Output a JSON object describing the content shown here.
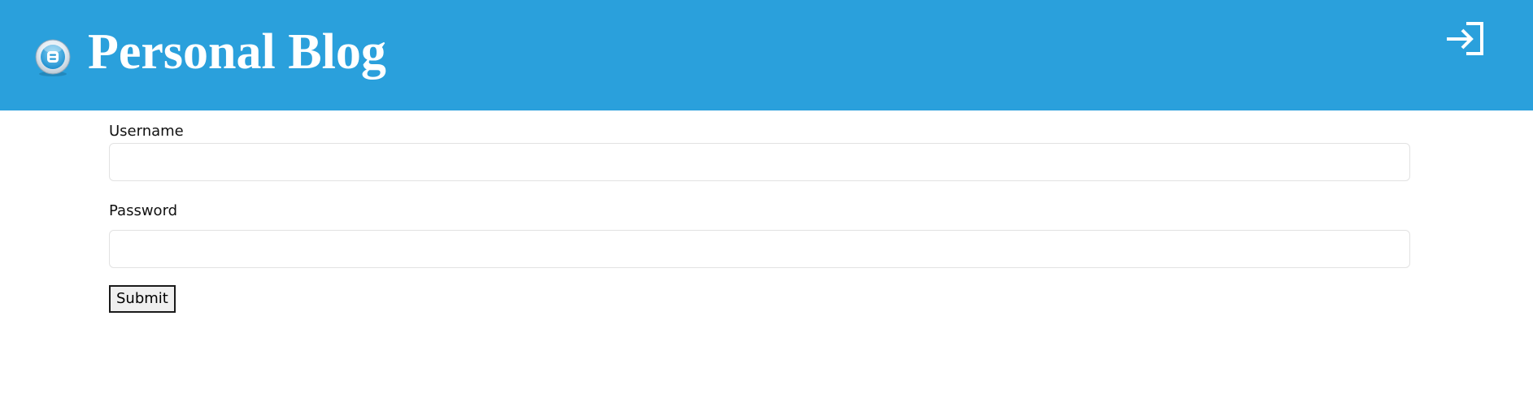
{
  "header": {
    "title": "Personal Blog",
    "logo_icon": "blogger-icon",
    "login_icon": "login-icon",
    "background_color": "#2aa0dc"
  },
  "form": {
    "username": {
      "label": "Username",
      "value": "",
      "placeholder": ""
    },
    "password": {
      "label": "Password",
      "value": "",
      "placeholder": ""
    },
    "submit_label": "Submit"
  }
}
